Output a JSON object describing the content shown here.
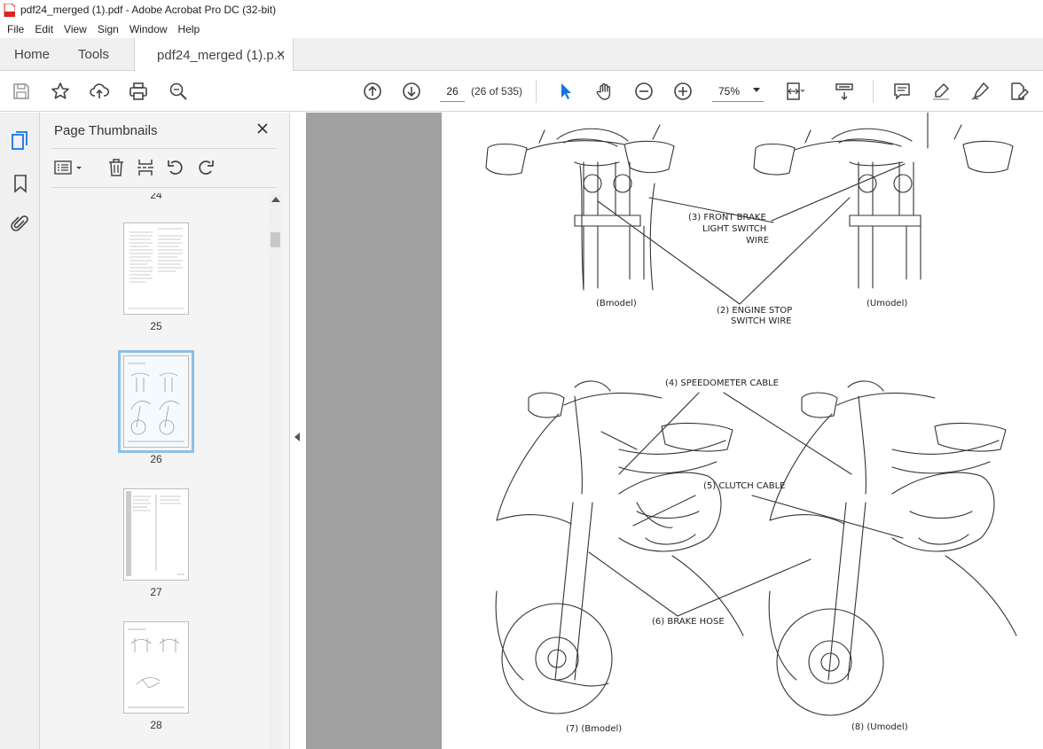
{
  "window": {
    "title": "pdf24_merged (1).pdf - Adobe Acrobat Pro DC (32-bit)"
  },
  "menu": [
    "File",
    "Edit",
    "View",
    "Sign",
    "Window",
    "Help"
  ],
  "tabs": {
    "home": "Home",
    "tools": "Tools",
    "document": "pdf24_merged (1).p..."
  },
  "toolbar": {
    "page_current": "26",
    "page_count": "(26 of 535)",
    "zoom": "75%"
  },
  "icons": {
    "titlebar": "pdf-file-icon",
    "toolbar": [
      "save-icon",
      "star-icon",
      "upload-icon",
      "print-icon",
      "search-zoom-icon",
      "page-up-icon",
      "page-down-icon",
      "select-cursor-icon",
      "hand-icon",
      "zoom-out-icon",
      "zoom-in-icon",
      "fit-page-icon",
      "scroll-mode-icon",
      "comment-icon",
      "highlight-icon",
      "sign-icon",
      "edit-pdf-icon"
    ],
    "leftrail": [
      "page-thumbnails-icon",
      "bookmark-icon",
      "attachment-icon"
    ],
    "panel_tools": [
      "options-icon",
      "delete-icon",
      "extract-icon",
      "rotate-left-icon",
      "rotate-right-icon"
    ]
  },
  "colors": {
    "accent": "#1473e6",
    "selection": "#8ec0e8",
    "viewer_bg": "#a0a0a0"
  },
  "thumbnails_panel": {
    "title": "Page Thumbnails",
    "partial_label": "24",
    "pages": [
      {
        "number": "25",
        "selected": false
      },
      {
        "number": "26",
        "selected": true
      },
      {
        "number": "27",
        "selected": false
      },
      {
        "number": "28",
        "selected": false
      }
    ]
  },
  "document_page": {
    "labels": {
      "front_brake": "(3) FRONT BRAKE",
      "light_switch": "LIGHT SWITCH",
      "wire": "WIRE",
      "b_model_top": "(Bmodel)",
      "u_model_top": "(Umodel)",
      "engine_stop": "(2) ENGINE STOP",
      "switch_wire": "SWITCH WIRE",
      "speedometer": "(4) SPEEDOMETER CABLE",
      "clutch": "(5) CLUTCH CABLE",
      "brake_hose": "(6) BRAKE HOSE",
      "b_model_bottom": "(7)  (Bmodel)",
      "u_model_bottom": "(8)  (Umodel)"
    }
  }
}
